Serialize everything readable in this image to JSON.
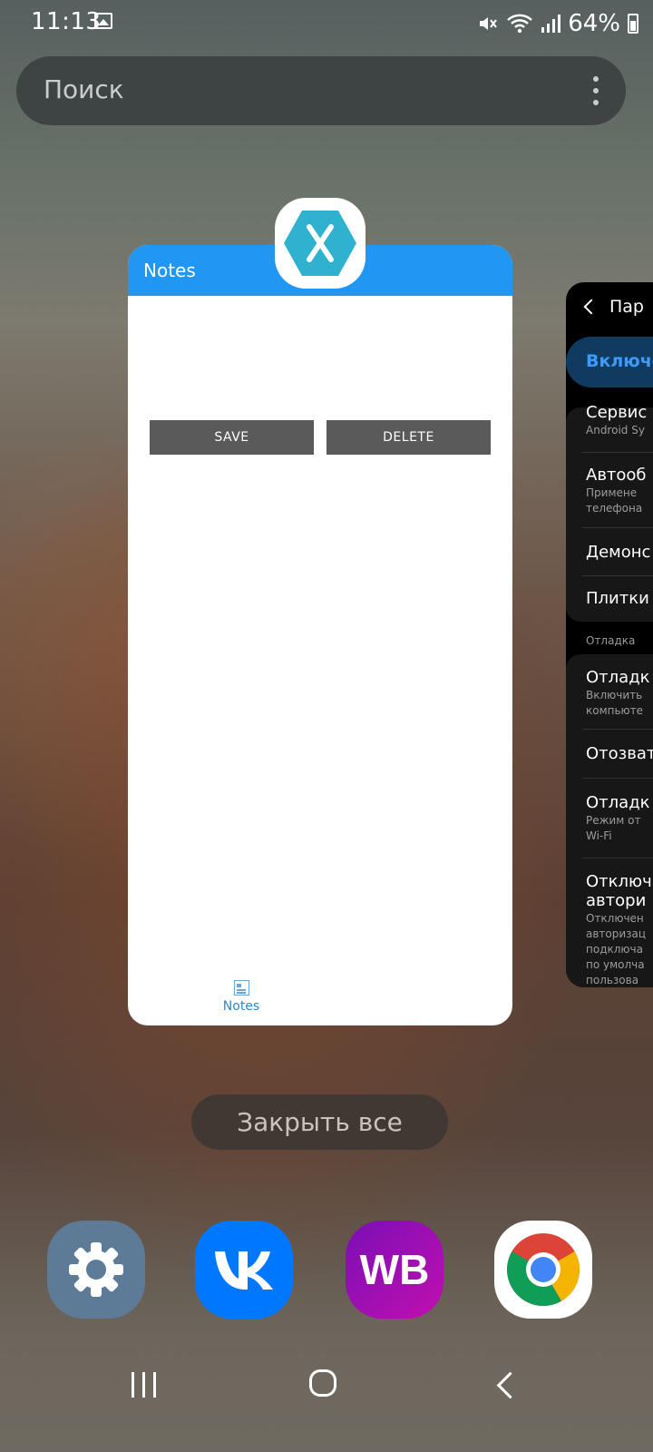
{
  "status_bar": {
    "time": "11:13",
    "battery": "64%"
  },
  "search": {
    "placeholder": "Поиск"
  },
  "app_card": {
    "title": "Notes",
    "buttons": {
      "save": "SAVE",
      "delete": "DELETE"
    },
    "tab_label": "Notes",
    "toolbar_color": "#2196f3"
  },
  "side_card": {
    "header": "Пар",
    "toggle": "Включе",
    "items": [
      {
        "title": "Сервис",
        "sub": [
          "Android Sy"
        ]
      },
      {
        "title": "Автооб",
        "sub": [
          "Примене",
          "телефона"
        ]
      },
      {
        "title": "Демонс",
        "sub": []
      },
      {
        "title": "Плитки",
        "sub": []
      },
      {
        "title": "Отладк",
        "sub": [
          "Включить",
          "компьюте"
        ]
      },
      {
        "title": "Отозват",
        "sub": []
      },
      {
        "title": "Отладк",
        "sub": [
          "Режим от",
          "Wi-Fi"
        ]
      },
      {
        "title": "Отключ",
        "title2": "автори",
        "sub": [
          "Отключен",
          "авторизац",
          "подключа",
          "по умолча",
          "пользова"
        ]
      }
    ],
    "section": "Отладка"
  },
  "close_all": "Закрыть все",
  "dock": {
    "wb_label": "WB",
    "apps": [
      "settings-icon",
      "vk-icon",
      "wildberries-icon",
      "chrome-icon"
    ]
  }
}
